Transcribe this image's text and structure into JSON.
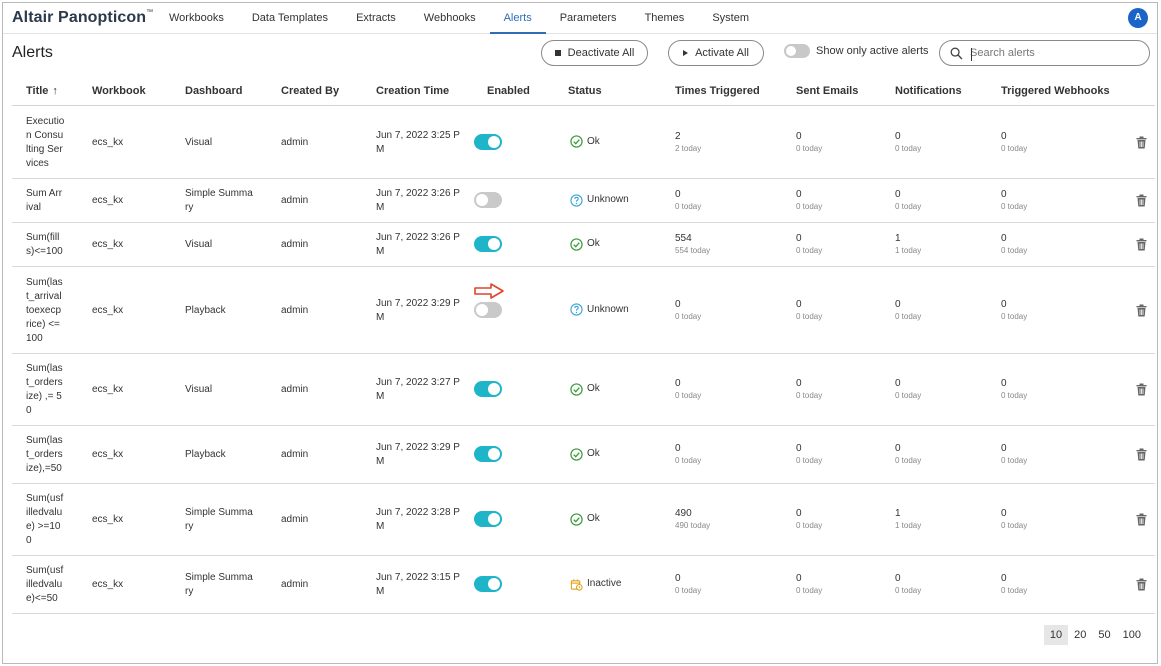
{
  "app": {
    "brand": "Altair Panopticon",
    "brand_mark": "™",
    "avatar_initial": "A"
  },
  "nav": {
    "tabs": [
      {
        "label": "Workbooks",
        "active": false
      },
      {
        "label": "Data Templates",
        "active": false
      },
      {
        "label": "Extracts",
        "active": false
      },
      {
        "label": "Webhooks",
        "active": false
      },
      {
        "label": "Alerts",
        "active": true
      },
      {
        "label": "Parameters",
        "active": false
      },
      {
        "label": "Themes",
        "active": false
      },
      {
        "label": "System",
        "active": false
      }
    ]
  },
  "toolbar": {
    "title": "Alerts",
    "deactivate_all": "Deactivate All",
    "activate_all": "Activate All",
    "show_active_label": "Show only active alerts",
    "show_active_on": false,
    "search_placeholder": "Search alerts"
  },
  "table": {
    "headers": {
      "title": "Title",
      "sort_indicator": "↑",
      "workbook": "Workbook",
      "dashboard": "Dashboard",
      "created_by": "Created By",
      "creation_time": "Creation Time",
      "enabled": "Enabled",
      "status": "Status",
      "times_triggered": "Times Triggered",
      "sent_emails": "Sent Emails",
      "notifications": "Notifications",
      "triggered_webhooks": "Triggered Webhooks"
    },
    "rows": [
      {
        "title": [
          "Executio",
          "n Consu",
          "lting Ser",
          "vices"
        ],
        "workbook": "ecs_kx",
        "dashboard": [
          "Visual"
        ],
        "created_by": "admin",
        "time": [
          "Jun 7, 2022 3:25 P",
          "M"
        ],
        "enabled": true,
        "status": "Ok",
        "status_icon": "check-circle-icon",
        "triggered": [
          "2",
          "2 today"
        ],
        "emails": [
          "0",
          "0 today"
        ],
        "notifications": [
          "0",
          "0 today"
        ],
        "webhooks": [
          "0",
          "0 today"
        ]
      },
      {
        "title": [
          "Sum Arr",
          "ival"
        ],
        "workbook": "ecs_kx",
        "dashboard": [
          "Simple Summa",
          "ry"
        ],
        "created_by": "admin",
        "time": [
          "Jun 7, 2022 3:26 P",
          "M"
        ],
        "enabled": false,
        "status": "Unknown",
        "status_icon": "question-circle-icon",
        "triggered": [
          "0",
          "0 today"
        ],
        "emails": [
          "0",
          "0 today"
        ],
        "notifications": [
          "0",
          "0 today"
        ],
        "webhooks": [
          "0",
          "0 today"
        ]
      },
      {
        "title": [
          "Sum(fill",
          "s)<=100"
        ],
        "workbook": "ecs_kx",
        "dashboard": [
          "Visual"
        ],
        "created_by": "admin",
        "time": [
          "Jun 7, 2022 3:26 P",
          "M"
        ],
        "enabled": true,
        "status": "Ok",
        "status_icon": "check-circle-icon",
        "triggered": [
          "554",
          "554 today"
        ],
        "emails": [
          "0",
          "0 today"
        ],
        "notifications": [
          "1",
          "1 today"
        ],
        "webhooks": [
          "0",
          "0 today"
        ]
      },
      {
        "title": [
          "Sum(las",
          "t_arrival",
          "toexecp",
          "rice) <=",
          "100"
        ],
        "workbook": "ecs_kx",
        "dashboard": [
          "Playback"
        ],
        "created_by": "admin",
        "time": [
          "Jun 7, 2022 3:29 P",
          "M"
        ],
        "enabled": false,
        "status": "Unknown",
        "status_icon": "question-circle-icon",
        "triggered": [
          "0",
          "0 today"
        ],
        "emails": [
          "0",
          "0 today"
        ],
        "notifications": [
          "0",
          "0 today"
        ],
        "webhooks": [
          "0",
          "0 today"
        ]
      },
      {
        "title": [
          "Sum(las",
          "t_orders",
          "ize) ,= 5",
          "0"
        ],
        "workbook": "ecs_kx",
        "dashboard": [
          "Visual"
        ],
        "created_by": "admin",
        "time": [
          "Jun 7, 2022 3:27 P",
          "M"
        ],
        "enabled": true,
        "status": "Ok",
        "status_icon": "check-circle-icon",
        "triggered": [
          "0",
          "0 today"
        ],
        "emails": [
          "0",
          "0 today"
        ],
        "notifications": [
          "0",
          "0 today"
        ],
        "webhooks": [
          "0",
          "0 today"
        ]
      },
      {
        "title": [
          "Sum(las",
          "t_orders",
          "ize),=50"
        ],
        "workbook": "ecs_kx",
        "dashboard": [
          "Playback"
        ],
        "created_by": "admin",
        "time": [
          "Jun 7, 2022 3:29 P",
          "M"
        ],
        "enabled": true,
        "status": "Ok",
        "status_icon": "check-circle-icon",
        "triggered": [
          "0",
          "0 today"
        ],
        "emails": [
          "0",
          "0 today"
        ],
        "notifications": [
          "0",
          "0 today"
        ],
        "webhooks": [
          "0",
          "0 today"
        ]
      },
      {
        "title": [
          "Sum(usf",
          "illedvalu",
          "e) >=10",
          "0"
        ],
        "workbook": "ecs_kx",
        "dashboard": [
          "Simple Summa",
          "ry"
        ],
        "created_by": "admin",
        "time": [
          "Jun 7, 2022 3:28 P",
          "M"
        ],
        "enabled": true,
        "status": "Ok",
        "status_icon": "check-circle-icon",
        "triggered": [
          "490",
          "490 today"
        ],
        "emails": [
          "0",
          "0 today"
        ],
        "notifications": [
          "1",
          "1 today"
        ],
        "webhooks": [
          "0",
          "0 today"
        ]
      },
      {
        "title": [
          "Sum(usf",
          "illedvalu",
          "e)<=50"
        ],
        "workbook": "ecs_kx",
        "dashboard": [
          "Simple Summa",
          "ry"
        ],
        "created_by": "admin",
        "time": [
          "Jun 7, 2022 3:15 P",
          "M"
        ],
        "enabled": true,
        "status": "Inactive",
        "status_icon": "inactive-clock-icon",
        "triggered": [
          "0",
          "0 today"
        ],
        "emails": [
          "0",
          "0 today"
        ],
        "notifications": [
          "0",
          "0 today"
        ],
        "webhooks": [
          "0",
          "0 today"
        ]
      }
    ]
  },
  "pager": {
    "sizes": [
      "10",
      "20",
      "50",
      "100"
    ],
    "selected": "10"
  },
  "colors": {
    "accent": "#2f6db5",
    "toggle_on": "#1fb5c9",
    "ok": "#3a9a3a",
    "unknown": "#3aa6d8",
    "inactive": "#e0a317",
    "annotation_arrow": "#e0442b"
  }
}
